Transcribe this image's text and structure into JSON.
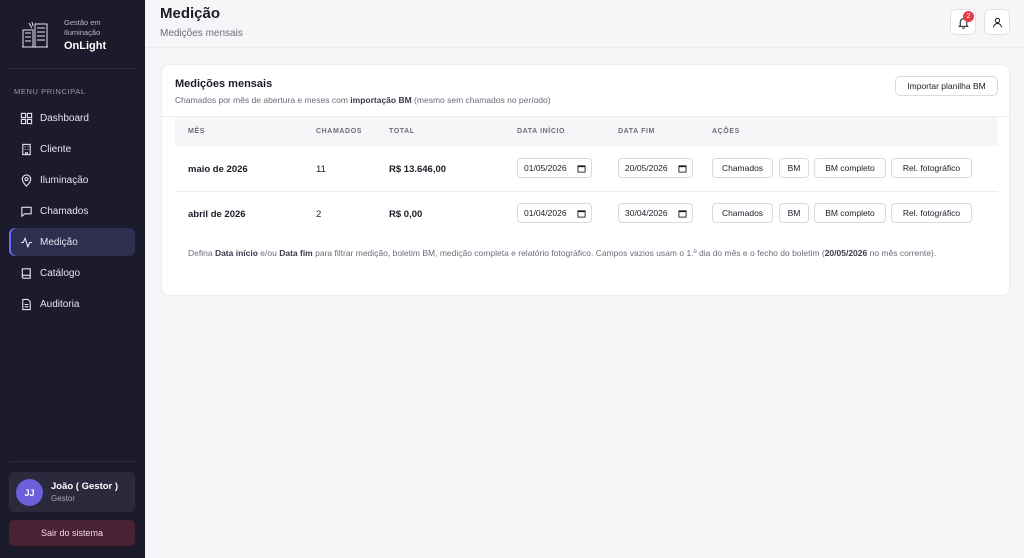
{
  "brand": {
    "subtitle": "Gestão em Iluminação",
    "name": "OnLight"
  },
  "sidebar": {
    "menu_title": "MENU PRINCIPAL",
    "items": [
      {
        "label": "Dashboard",
        "icon": "grid-icon"
      },
      {
        "label": "Cliente",
        "icon": "building-icon"
      },
      {
        "label": "Iluminação",
        "icon": "map-pin-icon"
      },
      {
        "label": "Chamados",
        "icon": "chat-icon"
      },
      {
        "label": "Medição",
        "icon": "activity-icon",
        "active": true
      },
      {
        "label": "Catálogo",
        "icon": "book-icon"
      },
      {
        "label": "Auditoria",
        "icon": "file-icon"
      }
    ],
    "user": {
      "initials": "JJ",
      "name": "João ( Gestor )",
      "role": "Gestor"
    },
    "logout_label": "Sair do sistema"
  },
  "header": {
    "title": "Medição",
    "subtitle": "Medições mensais",
    "notification_count": "2"
  },
  "card": {
    "title": "Medições mensais",
    "desc_prefix": "Chamados por mês de abertura e meses com ",
    "desc_bold": "importação BM",
    "desc_suffix": " (mesmo sem chamados no período)",
    "import_button": "Importar planilha BM",
    "columns": [
      "MÊS",
      "CHAMADOS",
      "TOTAL",
      "DATA INÍCIO",
      "DATA FIM",
      "AÇÕES"
    ],
    "rows": [
      {
        "month": "maio de 2026",
        "calls": "11",
        "total": "R$ 13.646,00",
        "start": "01/05/2026",
        "end": "20/05/2026"
      },
      {
        "month": "abril de 2026",
        "calls": "2",
        "total": "R$ 0,00",
        "start": "01/04/2026",
        "end": "30/04/2026"
      }
    ],
    "actions": [
      "Chamados",
      "BM",
      "BM completo",
      "Rel. fotográfico"
    ],
    "note": {
      "p1": "Defina ",
      "b1": "Data início",
      "p2": " e/ou ",
      "b2": "Data fim",
      "p3": " para filtrar medição, boletim BM, medição completa e relatório fotográfico. Campos vazios usam o 1.º dia do mês e o fecho do boletim (",
      "b3": "20/05/2026",
      "p4": " no mês corrente)."
    }
  },
  "colors": {
    "sidebar_bg": "#1b1b2b",
    "accent": "#6b6bff",
    "badge": "#e23b4a",
    "logout_bg": "#4a2233"
  }
}
